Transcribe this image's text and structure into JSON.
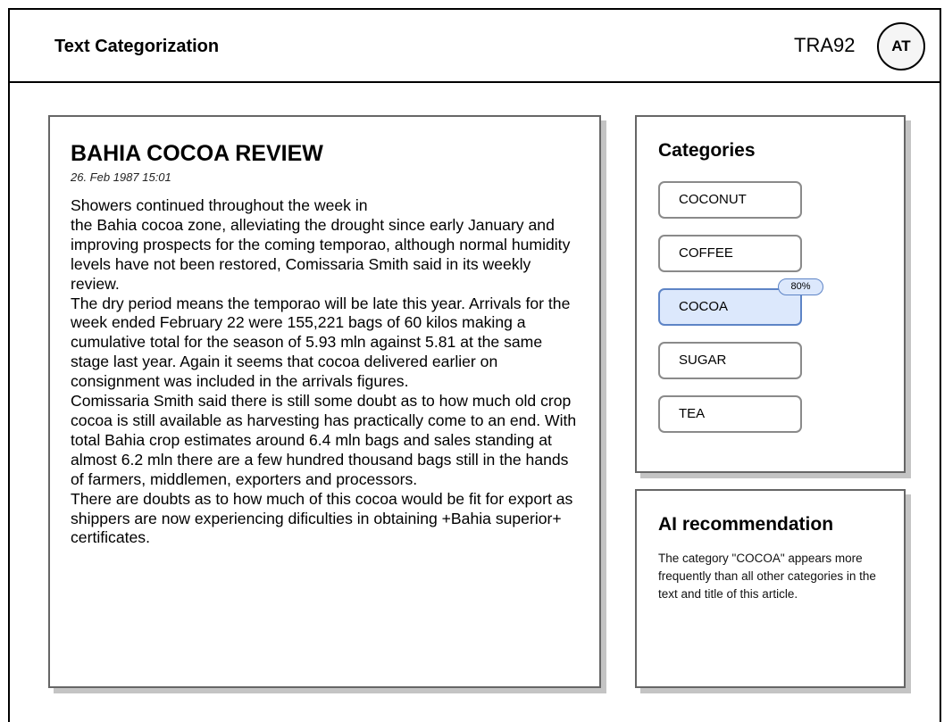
{
  "header": {
    "app_title": "Text Categorization",
    "user_id": "TRA92",
    "avatar_initials": "AT"
  },
  "article": {
    "title": "BAHIA COCOA REVIEW",
    "date": "26. Feb 1987 15:01",
    "paragraphs": [
      "Showers continued throughout the week in\nthe Bahia cocoa zone, alleviating the drought since early January and improving prospects for the coming temporao, although normal humidity levels have not been restored, Comissaria Smith said in its weekly review.",
      "The dry period means the temporao will be late this year. Arrivals for the week ended February 22 were 155,221 bags of 60 kilos making a cumulative total for the season of 5.93 mln against 5.81 at the same stage last year. Again it seems that cocoa delivered earlier on consignment was included in the arrivals figures.",
      "Comissaria Smith said there is still some doubt as to how much old crop cocoa is still available as harvesting has practically come to an end. With total Bahia crop estimates around 6.4 mln bags and sales standing at almost 6.2 mln there are a few hundred thousand bags still in the hands of farmers, middlemen, exporters and processors.",
      "There are doubts as to how much of this cocoa would be fit for export as shippers are now experiencing dificulties in obtaining +Bahia superior+ certificates."
    ]
  },
  "categories": {
    "title": "Categories",
    "items": [
      {
        "label": "COCONUT",
        "selected": false,
        "badge": ""
      },
      {
        "label": "COFFEE",
        "selected": false,
        "badge": ""
      },
      {
        "label": "COCOA",
        "selected": true,
        "badge": "80%"
      },
      {
        "label": "SUGAR",
        "selected": false,
        "badge": ""
      },
      {
        "label": "TEA",
        "selected": false,
        "badge": ""
      }
    ]
  },
  "ai_recommendation": {
    "title": "AI recommendation",
    "text": "The category \"COCOA\" appears more frequently than all other categories in the text and title of this article."
  },
  "colors": {
    "selected_bg": "#dce8fc",
    "selected_border": "#5d84c6"
  }
}
